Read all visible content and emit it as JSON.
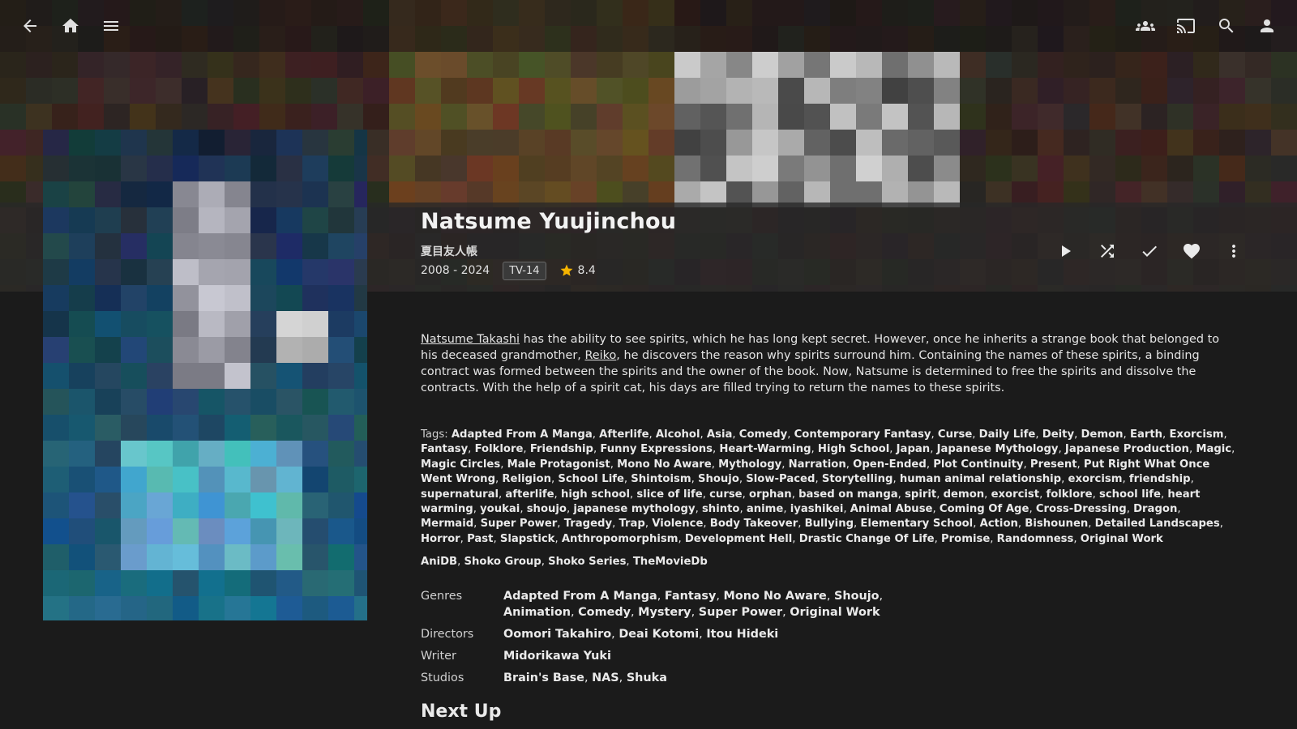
{
  "header": {
    "icons": [
      "back-arrow-icon",
      "home-icon",
      "menu-icon",
      "syncplay-group-icon",
      "cast-icon",
      "search-icon",
      "user-icon"
    ]
  },
  "item": {
    "title": "Natsume Yuujinchou",
    "original_title": "夏目友人帳",
    "years": "2008 - 2024",
    "official_rating": "TV-14",
    "community_rating": "8.4",
    "rating_star_color": "#f5b400"
  },
  "actions": [
    {
      "name": "play-button",
      "icon": "play-icon"
    },
    {
      "name": "shuffle-button",
      "icon": "shuffle-icon"
    },
    {
      "name": "mark-played-button",
      "icon": "check-icon"
    },
    {
      "name": "favorite-button",
      "icon": "heart-icon"
    },
    {
      "name": "more-button",
      "icon": "more-vert-icon"
    }
  ],
  "overview": {
    "link1": "Natsume Takashi",
    "text1": " has the ability to see spirits, which he has long kept secret. However, once he inherits a strange book that belonged to his deceased grandmother, ",
    "link2": "Reiko",
    "text2": ", he discovers the reason why spirits surround him. Containing the names of these spirits, a binding contract was formed between the spirits and the owner of the book. Now, Natsume is determined to free the spirits and dissolve the contracts. With the help of a spirit cat, his days are filled trying to return the names to these spirits."
  },
  "tags_label": "Tags:",
  "tags": [
    "Adapted From A Manga",
    "Afterlife",
    "Alcohol",
    "Asia",
    "Comedy",
    "Contemporary Fantasy",
    "Curse",
    "Daily Life",
    "Deity",
    "Demon",
    "Earth",
    "Exorcism",
    "Fantasy",
    "Folklore",
    "Friendship",
    "Funny Expressions",
    "Heart-Warming",
    "High School",
    "Japan",
    "Japanese Mythology",
    "Japanese Production",
    "Magic",
    "Magic Circles",
    "Male Protagonist",
    "Mono No Aware",
    "Mythology",
    "Narration",
    "Open-Ended",
    "Plot Continuity",
    "Present",
    "Put Right What Once Went Wrong",
    "Religion",
    "School Life",
    "Shintoism",
    "Shoujo",
    "Slow-Paced",
    "Storytelling",
    "human animal relationship",
    "exorcism",
    "friendship",
    "supernatural",
    "afterlife",
    "high school",
    "slice of life",
    "curse",
    "orphan",
    "based on manga",
    "spirit",
    "demon",
    "exorcist",
    "folklore",
    "school life",
    "heart warming",
    "youkai",
    "shoujo",
    "japanese mythology",
    "shinto",
    "anime",
    "iyashikei",
    "Animal Abuse",
    "Coming Of Age",
    "Cross-Dressing",
    "Dragon",
    "Mermaid",
    "Super Power",
    "Tragedy",
    "Trap",
    "Violence",
    "Body Takeover",
    "Bullying",
    "Elementary School",
    "Action",
    "Bishounen",
    "Detailed Landscapes",
    "Horror",
    "Past",
    "Slapstick",
    "Anthropomorphism",
    "Development Hell",
    "Drastic Change Of Life",
    "Promise",
    "Randomness",
    "Original Work"
  ],
  "providers": [
    "AniDB",
    "Shoko Group",
    "Shoko Series",
    "TheMovieDb"
  ],
  "info": [
    {
      "key": "Genres",
      "values": [
        "Adapted From A Manga",
        "Fantasy",
        "Mono No Aware",
        "Shoujo",
        "Animation",
        "Comedy",
        "Mystery",
        "Super Power",
        "Original Work"
      ]
    },
    {
      "key": "Directors",
      "values": [
        "Oomori Takahiro",
        "Deai Kotomi",
        "Itou Hideki"
      ]
    },
    {
      "key": "Writer",
      "values": [
        "Midorikawa Yuki"
      ]
    },
    {
      "key": "Studios",
      "values": [
        "Brain's Base",
        "NAS",
        "Shuka"
      ]
    }
  ],
  "next_up_title": "Next Up"
}
